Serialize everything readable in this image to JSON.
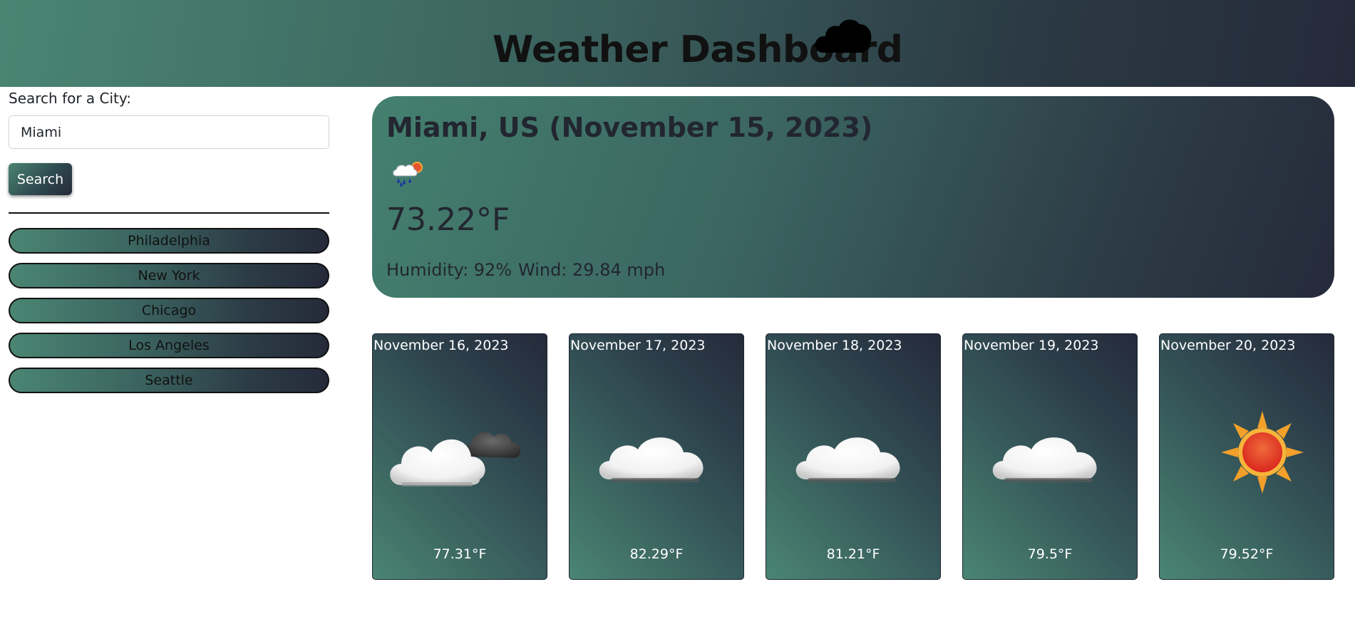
{
  "header": {
    "title": "Weather Dashboard",
    "icon": "cloud-icon"
  },
  "sidebar": {
    "search_label": "Search for a City:",
    "search_value": "Miami",
    "search_placeholder": "",
    "search_button_label": "Search",
    "history": [
      {
        "label": "Philadelphia"
      },
      {
        "label": "New York"
      },
      {
        "label": "Chicago"
      },
      {
        "label": "Los Angeles"
      },
      {
        "label": "Seattle"
      }
    ]
  },
  "current": {
    "title": "Miami, US (November 15, 2023)",
    "icon": "rain-sun-icon",
    "temperature": "73.22°F",
    "humidity": "Humidity: 92%",
    "wind": "Wind: 29.84 mph"
  },
  "forecast": [
    {
      "date": "November 16, 2023",
      "icon": "partly-cloudy-icon",
      "temp": "77.31°F"
    },
    {
      "date": "November 17, 2023",
      "icon": "cloud-icon",
      "temp": "82.29°F"
    },
    {
      "date": "November 18, 2023",
      "icon": "cloud-icon",
      "temp": "81.21°F"
    },
    {
      "date": "November 19, 2023",
      "icon": "cloud-icon",
      "temp": "79.5°F"
    },
    {
      "date": "November 20, 2023",
      "icon": "sun-icon",
      "temp": "79.52°F"
    }
  ],
  "colors": {
    "gradient_start": "#4a8572",
    "gradient_end": "#252a3a",
    "text_dark": "#222630",
    "text_light": "#ffffff"
  }
}
